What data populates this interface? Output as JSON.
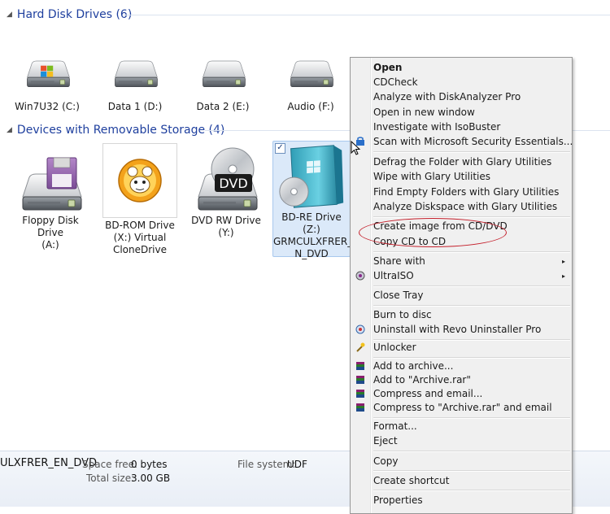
{
  "groups": {
    "hard_disks": "Hard Disk Drives (6)",
    "removable": "Devices with Removable Storage (4)"
  },
  "hard_drives": [
    {
      "label": "Win7U32 (C:)"
    },
    {
      "label": "Data 1 (D:)"
    },
    {
      "label": "Data 2 (E:)"
    },
    {
      "label": "Audio (F:)"
    }
  ],
  "removable": {
    "floppy": [
      "Floppy Disk Drive",
      "(A:)"
    ],
    "bdrom": [
      "BD-ROM Drive",
      "(X:) Virtual",
      "CloneDrive"
    ],
    "dvdrw": [
      "DVD RW Drive",
      "(Y:)"
    ],
    "bdre": [
      "BD-RE Drive (Z:)",
      "GRMCULXFRER_E",
      "N_DVD"
    ],
    "dvd_disc_text": "DVD",
    "bdre_checked": "✓"
  },
  "details": {
    "title": "ULXFRER_EN_DVD",
    "space_free_label": "Space free:",
    "space_free_value": "0 bytes",
    "total_size_label": "Total size:",
    "total_size_value": "3.00 GB",
    "file_system_label": "File system:",
    "file_system_value": "UDF"
  },
  "menu": {
    "open": "Open",
    "cdcheck": "CDCheck",
    "analyze_da": "Analyze with DiskAnalyzer Pro",
    "open_new_window": "Open in new window",
    "isobuster": "Investigate with IsoBuster",
    "mse": "Scan with Microsoft Security Essentials...",
    "defrag": "Defrag the Folder with Glary Utilities",
    "wipe": "Wipe with Glary Utilities",
    "empty_folders": "Find Empty Folders with Glary Utilities",
    "diskspace": "Analyze Diskspace with Glary Utilities",
    "create_image": "Create image from CD/DVD",
    "copy_cd": "Copy CD to CD",
    "share_with": "Share with",
    "ultraiso": "UltraISO",
    "close_tray": "Close Tray",
    "burn": "Burn to disc",
    "revo": "Uninstall with Revo Uninstaller Pro",
    "unlocker": "Unlocker",
    "add_archive": "Add to archive...",
    "add_archive_rar": "Add to \"Archive.rar\"",
    "compress_email": "Compress and email...",
    "compress_rar_email": "Compress to \"Archive.rar\" and email",
    "format": "Format...",
    "eject": "Eject",
    "copy": "Copy",
    "create_shortcut": "Create shortcut",
    "properties": "Properties",
    "submenu_arrow": "▸"
  },
  "colors": {
    "group_header": "#1e3f9e",
    "highlight_ellipse": "#c41e2a",
    "menu_bg": "#f0f0f0",
    "selection": "#dbe9f9"
  },
  "icons": {
    "defender": "shield-icon",
    "ultraiso": "ultraiso-icon",
    "revo": "revo-icon",
    "unlocker": "unlocker-wand-icon",
    "winrar": "winrar-books-icon"
  }
}
